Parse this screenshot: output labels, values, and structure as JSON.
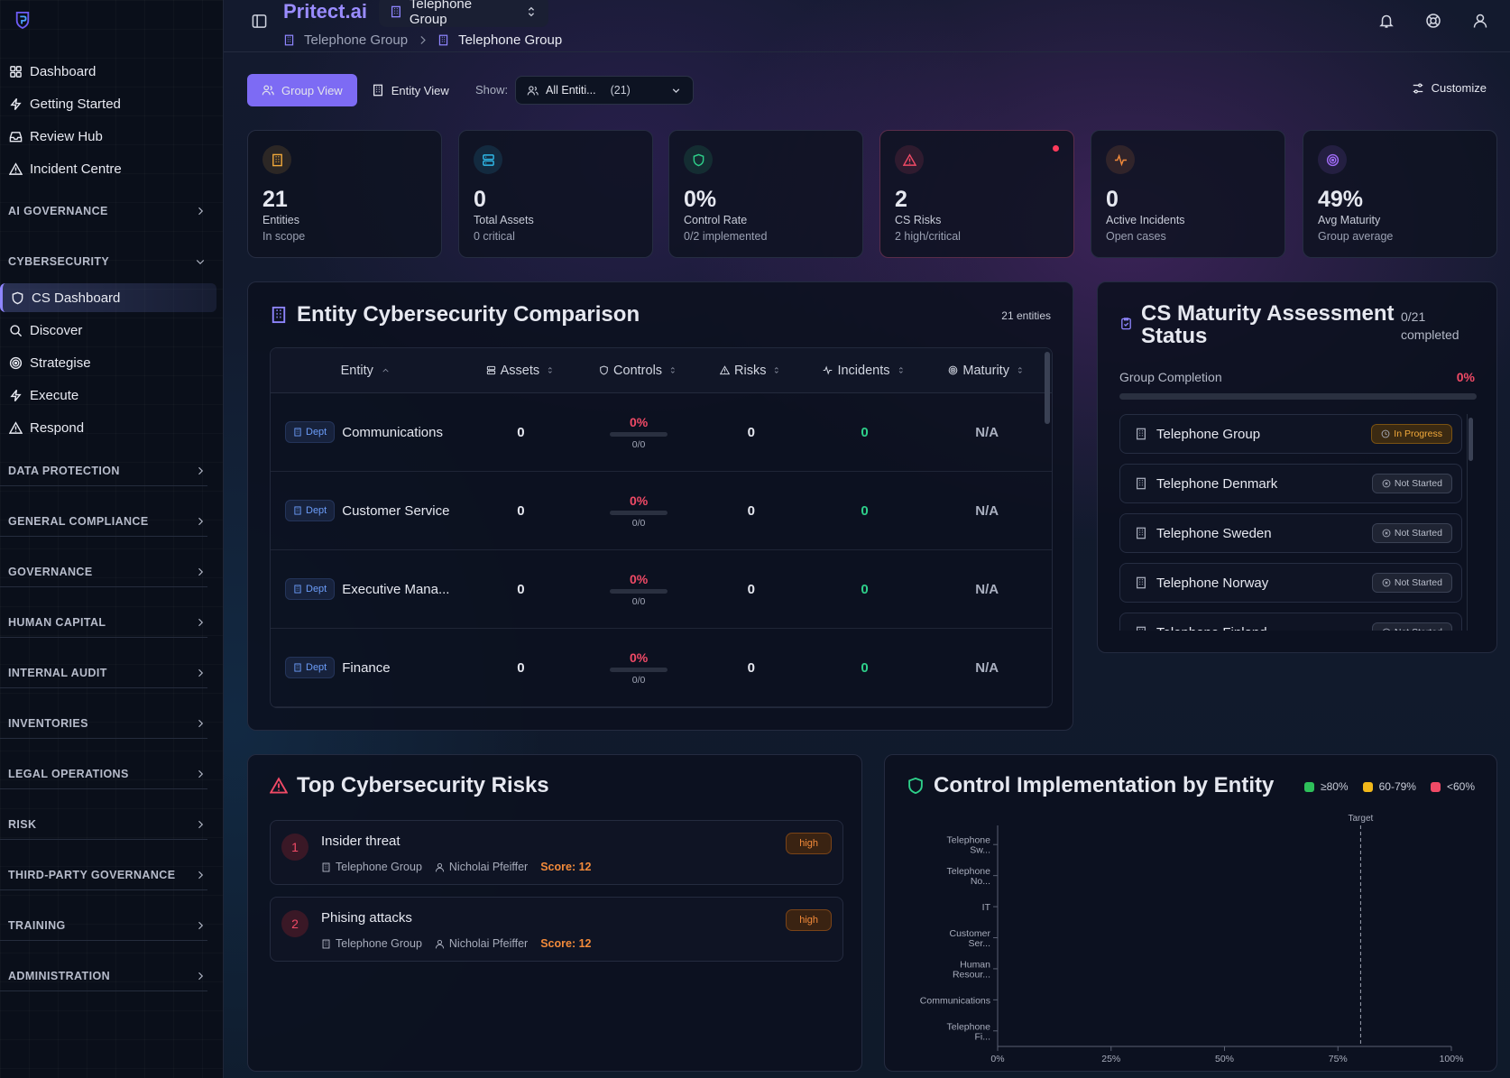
{
  "brand": "Pritect.ai",
  "group_selector": "Telephone Group",
  "breadcrumb": [
    "Telephone Group",
    "Telephone Group"
  ],
  "sidebar": {
    "items": [
      "Dashboard",
      "Getting Started",
      "Review Hub",
      "Incident Centre"
    ],
    "cyber_items": [
      "CS Dashboard",
      "Discover",
      "Strategise",
      "Execute",
      "Respond"
    ],
    "sections": [
      "AI GOVERNANCE",
      "CYBERSECURITY",
      "DATA PROTECTION",
      "GENERAL COMPLIANCE",
      "GOVERNANCE",
      "HUMAN CAPITAL",
      "INTERNAL AUDIT",
      "INVENTORIES",
      "LEGAL OPERATIONS",
      "RISK",
      "THIRD-PARTY GOVERNANCE",
      "TRAINING",
      "ADMINISTRATION"
    ]
  },
  "toolbar": {
    "group_view": "Group View",
    "entity_view": "Entity View",
    "show_label": "Show:",
    "show_value": "All Entiti...",
    "show_count": "(21)",
    "customize": "Customize"
  },
  "kpis": [
    {
      "value": "21",
      "label": "Entities",
      "sub": "In scope",
      "color": "#f2a93a"
    },
    {
      "value": "0",
      "label": "Total Assets",
      "sub": "0 critical",
      "color": "#2fb8e8"
    },
    {
      "value": "0%",
      "label": "Control Rate",
      "sub": "0/2 implemented",
      "color": "#2ed08a"
    },
    {
      "value": "2",
      "label": "CS Risks",
      "sub": "2 high/critical",
      "color": "#f04a66"
    },
    {
      "value": "0",
      "label": "Active Incidents",
      "sub": "Open cases",
      "color": "#f28a3a"
    },
    {
      "value": "49%",
      "label": "Avg Maturity",
      "sub": "Group average",
      "color": "#a06cf6"
    }
  ],
  "comparison": {
    "title": "Entity Cybersecurity Comparison",
    "count": "21 entities",
    "columns": [
      "Entity",
      "Assets",
      "Controls",
      "Risks",
      "Incidents",
      "Maturity"
    ],
    "dept_label": "Dept",
    "rows": [
      {
        "entity": "Communications",
        "assets": "0",
        "controls_pct": "0%",
        "controls_frac": "0/0",
        "risks": "0",
        "incidents": "0",
        "maturity": "N/A"
      },
      {
        "entity": "Customer Service",
        "assets": "0",
        "controls_pct": "0%",
        "controls_frac": "0/0",
        "risks": "0",
        "incidents": "0",
        "maturity": "N/A"
      },
      {
        "entity": "Executive Mana...",
        "assets": "0",
        "controls_pct": "0%",
        "controls_frac": "0/0",
        "risks": "0",
        "incidents": "0",
        "maturity": "N/A"
      },
      {
        "entity": "Finance",
        "assets": "0",
        "controls_pct": "0%",
        "controls_frac": "0/0",
        "risks": "0",
        "incidents": "0",
        "maturity": "N/A"
      }
    ]
  },
  "maturity": {
    "title_line1": "CS Maturity Assessment",
    "title_line2": "Status",
    "completed_count": "0/21",
    "completed_label": "completed",
    "group_completion_label": "Group Completion",
    "group_completion_value": "0%",
    "items": [
      {
        "name": "Telephone Group",
        "status": "In Progress"
      },
      {
        "name": "Telephone Denmark",
        "status": "Not Started"
      },
      {
        "name": "Telephone Sweden",
        "status": "Not Started"
      },
      {
        "name": "Telephone Norway",
        "status": "Not Started"
      },
      {
        "name": "Telephone Finland",
        "status": "Not Started"
      }
    ]
  },
  "risks": {
    "title": "Top Cybersecurity Risks",
    "items": [
      {
        "num": "1",
        "title": "Insider threat",
        "entity": "Telephone Group",
        "owner": "Nicholai Pfeiffer",
        "score": "Score: 12",
        "level": "high"
      },
      {
        "num": "2",
        "title": "Phising attacks",
        "entity": "Telephone Group",
        "owner": "Nicholai Pfeiffer",
        "score": "Score: 12",
        "level": "high"
      }
    ]
  },
  "chart_data": {
    "type": "bar",
    "orientation": "horizontal",
    "title": "Control Implementation by Entity",
    "legend": [
      {
        "label": "≥80%",
        "color": "#2ec05a"
      },
      {
        "label": "60-79%",
        "color": "#f2b81a"
      },
      {
        "label": "<60%",
        "color": "#f04a66"
      }
    ],
    "categories": [
      [
        "Telephone",
        "Sw..."
      ],
      [
        "Telephone",
        "No..."
      ],
      [
        "IT"
      ],
      [
        "Customer",
        "Ser..."
      ],
      [
        "Human",
        "Resour..."
      ],
      [
        "Communications"
      ],
      [
        "Telephone",
        "Fi..."
      ]
    ],
    "values": [
      0,
      0,
      0,
      0,
      0,
      0,
      0
    ],
    "xlim": [
      0,
      100
    ],
    "xticks": [
      "0%",
      "25%",
      "50%",
      "75%",
      "100%"
    ],
    "target_label": "Target",
    "target_value": 80
  }
}
